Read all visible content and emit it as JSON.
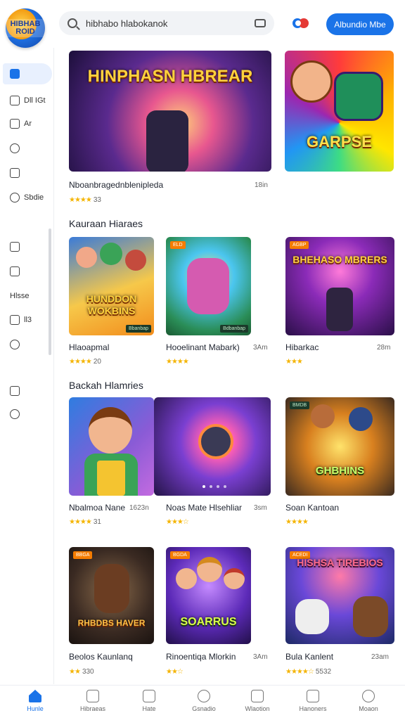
{
  "header": {
    "logo_text": "HIBHAB ROID",
    "search_text": "hibhabo hlabokanok",
    "cta_label": "Albundio Mbe"
  },
  "sidebar": {
    "items": [
      {
        "label": "",
        "icon": "home-icon"
      },
      {
        "label": "Dll IGt",
        "icon": "grid-icon"
      },
      {
        "label": "Ar",
        "icon": "tag-icon"
      },
      {
        "label": "",
        "icon": "circle-icon"
      },
      {
        "label": "",
        "icon": "chart-icon"
      },
      {
        "label": "Sbdie",
        "icon": "clock-icon"
      },
      {
        "label": "",
        "icon": "shield-icon"
      },
      {
        "label": "",
        "icon": "card-icon"
      },
      {
        "label": "Hlsse",
        "icon": "text-icon"
      },
      {
        "label": "ll3",
        "icon": "list-icon"
      },
      {
        "label": "",
        "icon": "compass-icon"
      },
      {
        "label": "",
        "icon": "image-icon"
      },
      {
        "label": "",
        "icon": "info-icon"
      }
    ]
  },
  "featured": [
    {
      "thumb_text": "HINPHASN HBREAR",
      "title": "Nboanbragednblenipleda",
      "meta": "18in",
      "rating": "33",
      "stars": "★★★★"
    },
    {
      "thumb_text": "GARPSE",
      "title": "",
      "meta": "",
      "rating": "",
      "stars": ""
    }
  ],
  "sections": [
    {
      "title": "Kauraan Hiaraes",
      "cards": [
        {
          "thumb_text": "HUNDDON WOKBINS",
          "badge": "",
          "badge2": "Bbanbap",
          "title": "Hlaoapmal",
          "meta": "",
          "rating": "20",
          "stars": "★★★★"
        },
        {
          "thumb_text": "",
          "badge": "ELD",
          "badge2": "Bdbanbap",
          "title": "Hooelinant Mabark)",
          "meta": "3Am",
          "rating": "",
          "stars": "★★★★"
        },
        {
          "thumb_text": "BHEHASO MBRERS",
          "badge": "AGBP",
          "badge2": "",
          "title": "Hibarkac",
          "meta": "28m",
          "rating": "",
          "stars": "★★★"
        }
      ]
    },
    {
      "title": "Backah Hlamries",
      "cards": [
        {
          "thumb_text": "",
          "badge": "",
          "badge2": "",
          "title": "Nbalmoa Nane",
          "meta": "1623n",
          "rating": "31",
          "stars": "★★★★"
        },
        {
          "thumb_text": "",
          "badge": "",
          "badge2": "",
          "title": "Noas Mate Hlsehliar",
          "meta": "3sm",
          "rating": "",
          "stars": "★★★☆"
        },
        {
          "thumb_text": "GHBHINS",
          "badge": "BMDB",
          "badge2": "",
          "title": "Soan Kantoan",
          "meta": "",
          "rating": "",
          "stars": "★★★★"
        }
      ]
    },
    {
      "title": "",
      "cards": [
        {
          "thumb_text": "RHBDBS HAVER",
          "badge": "BBGA",
          "badge2": "",
          "title": "Beolos Kaunlanq",
          "meta": "",
          "rating": "330",
          "stars": "★★"
        },
        {
          "thumb_text": "SOARRUS",
          "badge": "BGDA",
          "badge2": "",
          "title": "Rinoentiqa Mlorkin",
          "meta": "3Am",
          "rating": "",
          "stars": "★★☆"
        },
        {
          "thumb_text": "HISHSA TIREBIOS",
          "badge": "ACEDI",
          "badge2": "",
          "title": "Bula Kanlent",
          "meta": "23am",
          "rating": "5532",
          "stars": "★★★★☆"
        }
      ]
    }
  ],
  "bottom_nav": [
    {
      "label": "Hunle",
      "icon": "home-icon",
      "active": true
    },
    {
      "label": "Hibraeas",
      "icon": "shape-icon"
    },
    {
      "label": "Hate",
      "icon": "calendar-icon"
    },
    {
      "label": "Gsnadio",
      "icon": "refresh-icon"
    },
    {
      "label": "Wlaotion",
      "icon": "book-icon"
    },
    {
      "label": "Hanoners",
      "icon": "mail-icon"
    },
    {
      "label": "Moaon",
      "icon": "user-icon"
    }
  ],
  "colors": {
    "accent": "#1a73e8",
    "star": "#f4b400"
  }
}
